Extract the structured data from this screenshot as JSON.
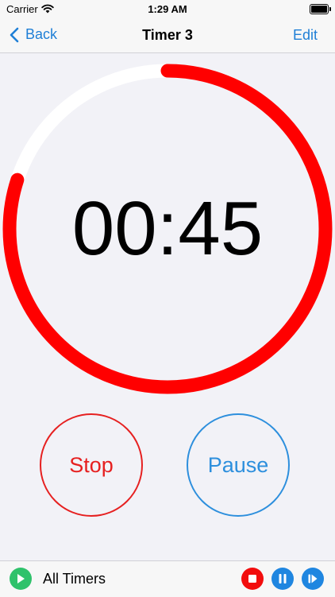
{
  "status": {
    "carrier": "Carrier",
    "time": "1:29 AM"
  },
  "nav": {
    "back_label": "Back",
    "title": "Timer 3",
    "edit_label": "Edit"
  },
  "timer": {
    "display": "00:45",
    "remaining_fraction": 0.8
  },
  "buttons": {
    "stop_label": "Stop",
    "pause_label": "Pause"
  },
  "bottom": {
    "all_timers_label": "All Timers"
  },
  "colors": {
    "accent": "#1f7fd6",
    "ring": "#ff0000",
    "ring_track": "#ffffff",
    "stop": "#e62020",
    "pause": "#2d8fdd",
    "play": "#2fc26b"
  },
  "icons": [
    "wifi-icon",
    "battery-icon",
    "chevron-left-icon",
    "play-icon",
    "stop-icon",
    "pause-icon",
    "skip-next-icon"
  ]
}
